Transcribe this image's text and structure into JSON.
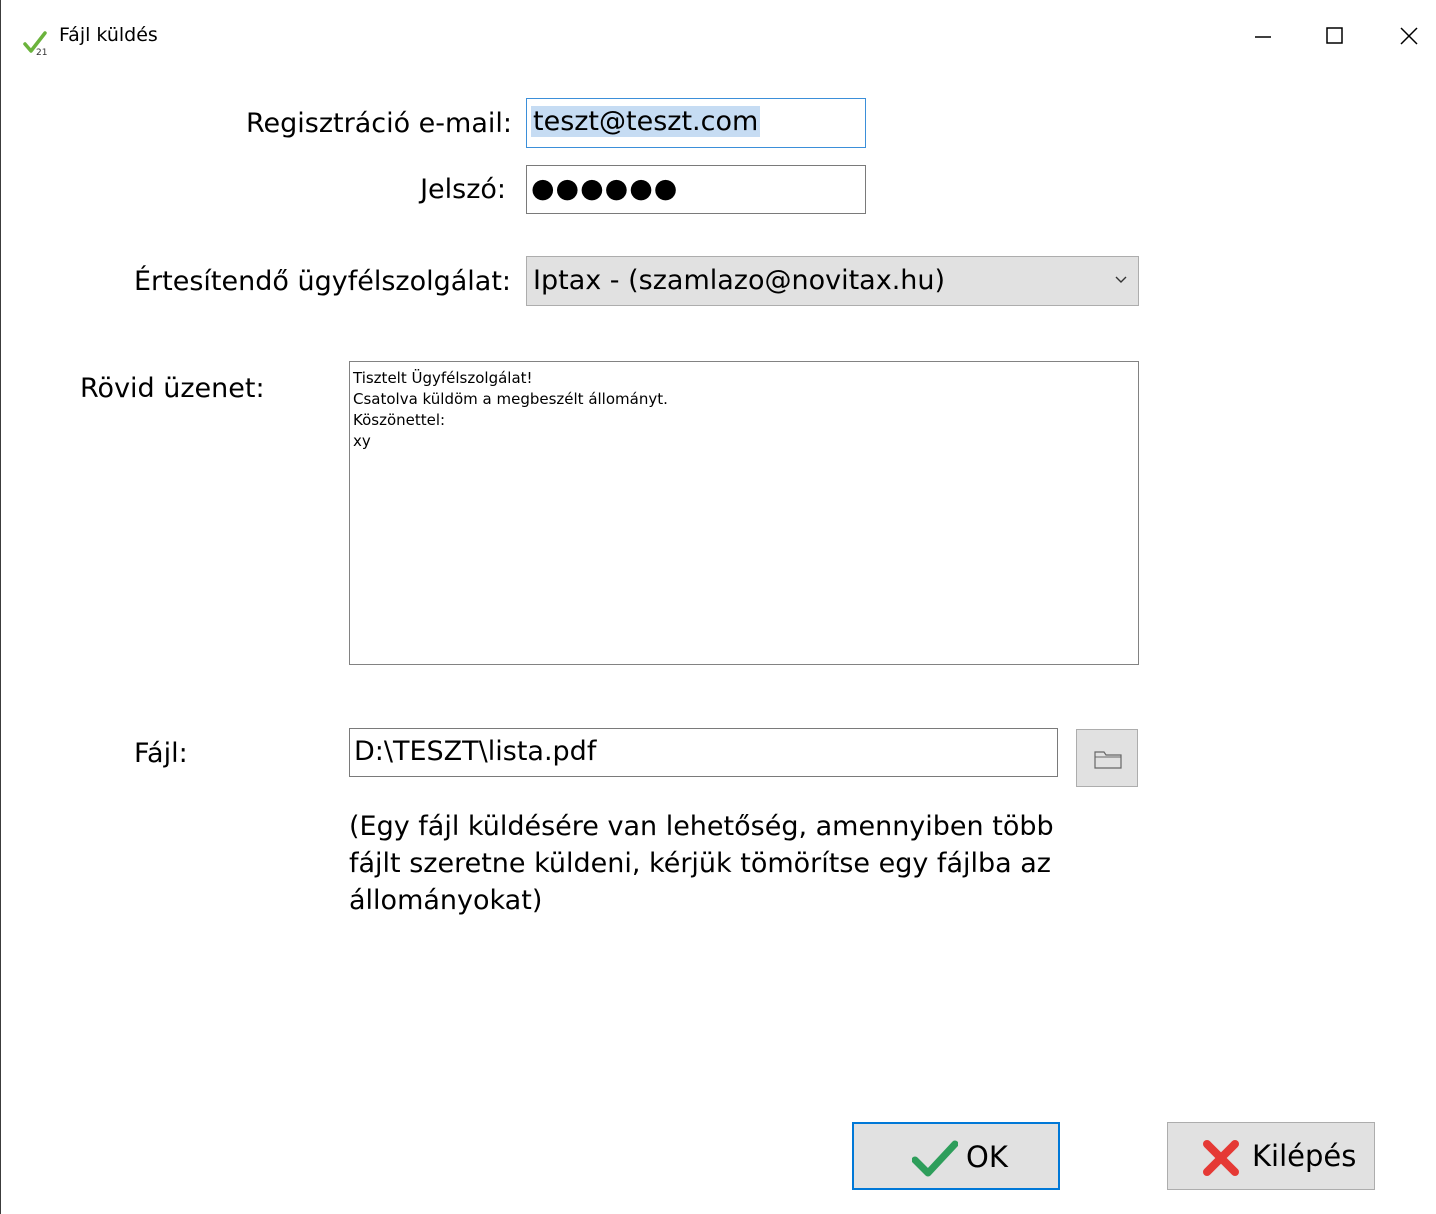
{
  "window": {
    "title": "Fájl küldés",
    "controls": {
      "minimize": "minimize",
      "maximize": "maximize",
      "close": "close"
    }
  },
  "form": {
    "email": {
      "label": "Regisztráció e-mail:",
      "value": "teszt@teszt.com"
    },
    "password": {
      "label": "Jelszó:",
      "value": "●●●●●●"
    },
    "support": {
      "label": "Értesítendő ügyfélszolgálat:",
      "selected": "Iptax - (szamlazo@novitax.hu)"
    },
    "message": {
      "label": "Rövid üzenet:",
      "lines": [
        "Tisztelt Ügyfélszolgálat!",
        "",
        "Csatolva küldöm a megbeszélt állományt.",
        "",
        "Köszönettel:",
        "xy"
      ]
    },
    "file": {
      "label": "Fájl:",
      "value": "D:\\TESZT\\lista.pdf"
    },
    "note": [
      "(Egy fájl küldésére van lehetőség, amennyiben több",
      "fájlt szeretne küldeni, kérjük tömörítse egy fájlba az",
      "állományokat)"
    ]
  },
  "buttons": {
    "ok": "OK",
    "exit": "Kilépés"
  },
  "colors": {
    "accent": "#0078d7",
    "ok_check": "#2e9e5b",
    "exit_x": "#e53935",
    "selection": "#c6dcf3"
  },
  "icons": {
    "app": "check-21-icon",
    "browse": "folder-icon",
    "ok": "checkmark-icon",
    "exit": "x-icon"
  }
}
